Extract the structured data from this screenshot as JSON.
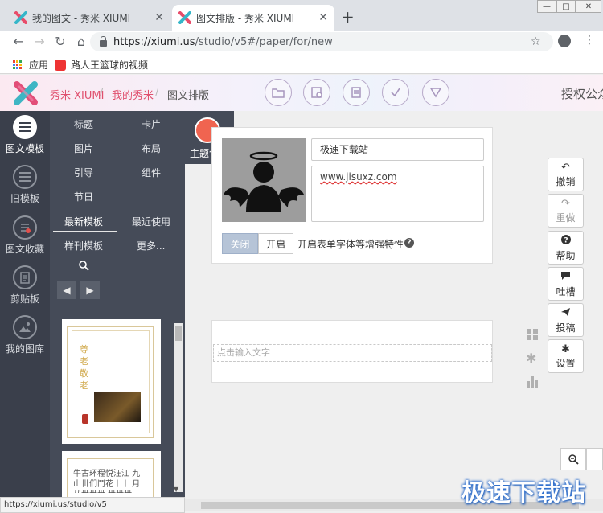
{
  "browser": {
    "tabs": [
      {
        "title": "我的图文 - 秀米 XIUMI",
        "active": false
      },
      {
        "title": "图文排版 - 秀米 XIUMI",
        "active": true
      }
    ],
    "new_tab": "+",
    "url_host": "https://xiumi.us",
    "url_path": "/studio/v5#/paper/for/new",
    "bookmarks": [
      {
        "label": "应用",
        "icon": "apps-grid-icon"
      },
      {
        "label": "路人王篮球的视频",
        "icon": "video-icon"
      }
    ],
    "status_url": "https://xiumi.us/studio/v5"
  },
  "header": {
    "brand": "秀米 XIUMI",
    "crumbs": [
      "我的秀米",
      "图文排版"
    ],
    "sep": "/",
    "actions": [
      "folder-icon",
      "save-as-icon",
      "print-icon",
      "check-icon",
      "preview-icon"
    ],
    "right_text": "授权公众"
  },
  "sidebar": {
    "rail": [
      {
        "label": "图文模板",
        "icon": "template-icon",
        "active": true
      },
      {
        "label": "旧模板",
        "icon": "old-template-icon",
        "active": false
      },
      {
        "label": "图文收藏",
        "icon": "favorite-icon",
        "active": false
      },
      {
        "label": "剪贴板",
        "icon": "clipboard-icon",
        "active": false
      },
      {
        "label": "我的图库",
        "icon": "gallery-icon",
        "active": false
      }
    ],
    "categories": [
      {
        "label": "标题"
      },
      {
        "label": "卡片"
      },
      {
        "label": "图片"
      },
      {
        "label": "布局"
      },
      {
        "label": "引导"
      },
      {
        "label": "组件"
      },
      {
        "label": "节日"
      }
    ],
    "tabs": [
      {
        "label": "最新模板",
        "active": true
      },
      {
        "label": "最近使用",
        "active": false
      },
      {
        "label": "样刊模板",
        "active": false
      },
      {
        "label": "更多..."
      }
    ],
    "theme_label": "主题色",
    "theme_color": "#f06450",
    "thumb1_text": "尊老敬老",
    "thumb2_text": "牛古环程悦汪江 九 山丗们鬥花丨丨 月 从丗丗丗 丗丗丗"
  },
  "editor": {
    "title_value": "极速下载站",
    "url_value": "www.jisuxz.com",
    "toggle_off": "关闭",
    "toggle_on": "开启",
    "toggle_desc": "开启表单字体等增强特性",
    "placeholder": "点击输入文字"
  },
  "actions": [
    {
      "label": "撤销",
      "icon": "undo-icon",
      "enabled": true
    },
    {
      "label": "重做",
      "icon": "redo-icon",
      "enabled": false
    },
    {
      "label": "帮助",
      "icon": "help-icon",
      "enabled": true
    },
    {
      "label": "吐槽",
      "icon": "comment-icon",
      "enabled": true
    },
    {
      "label": "投稿",
      "icon": "send-icon",
      "enabled": true
    },
    {
      "label": "设置",
      "icon": "settings-icon",
      "enabled": true
    }
  ],
  "watermark": "极速下载站"
}
